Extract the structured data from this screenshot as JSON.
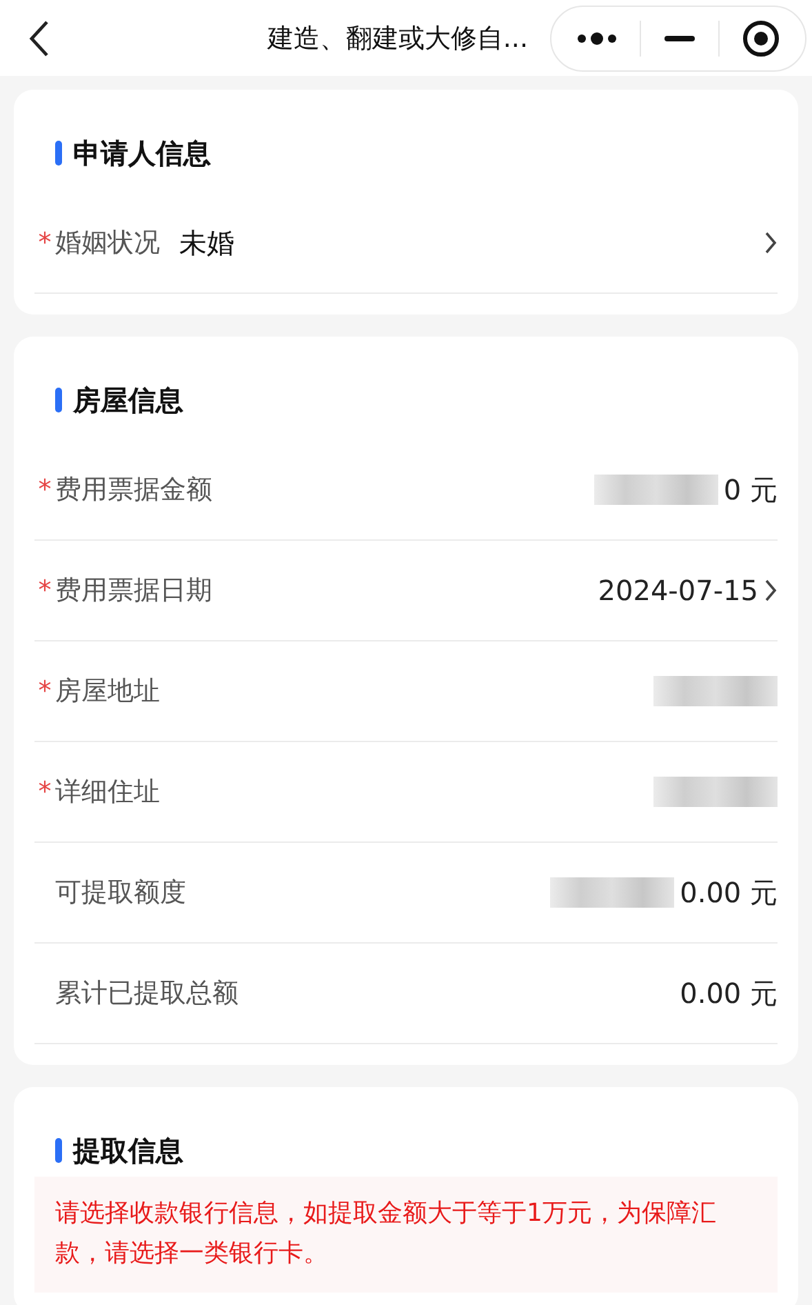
{
  "nav_bar": {
    "title": "建造、翻建或大修自..."
  },
  "sections": [
    {
      "title": "申请人信息",
      "kind": "inline",
      "rows": [
        {
          "label": "婚姻状况",
          "mark": "*",
          "value": "未婚",
          "redacted": false,
          "arrow": true
        }
      ]
    },
    {
      "title": "房屋信息",
      "kind": "right",
      "rows": [
        {
          "label": "费用票据金额",
          "mark": "*",
          "value": "0 元",
          "redacted": true,
          "arrow": false
        },
        {
          "label": "费用票据日期",
          "mark": "*",
          "value": "2024-07-15",
          "redacted": false,
          "arrow": true
        },
        {
          "label": "房屋地址",
          "mark": "*",
          "redacted": true,
          "arrow": false
        },
        {
          "label": "详细住址",
          "mark": "*",
          "redacted": true,
          "arrow": false
        },
        {
          "label": "可提取额度",
          "value": "0.00 元",
          "redacted": true,
          "arrow": false
        },
        {
          "label": "累计已提取总额",
          "value": "0.00 元",
          "redacted": false,
          "arrow": false
        }
      ]
    },
    {
      "title": "提取信息",
      "kind": "notice",
      "notice": "请选择收款银行信息，如提取金额大于等于1万元，为保障汇款，请选择一类银行卡。"
    }
  ]
}
